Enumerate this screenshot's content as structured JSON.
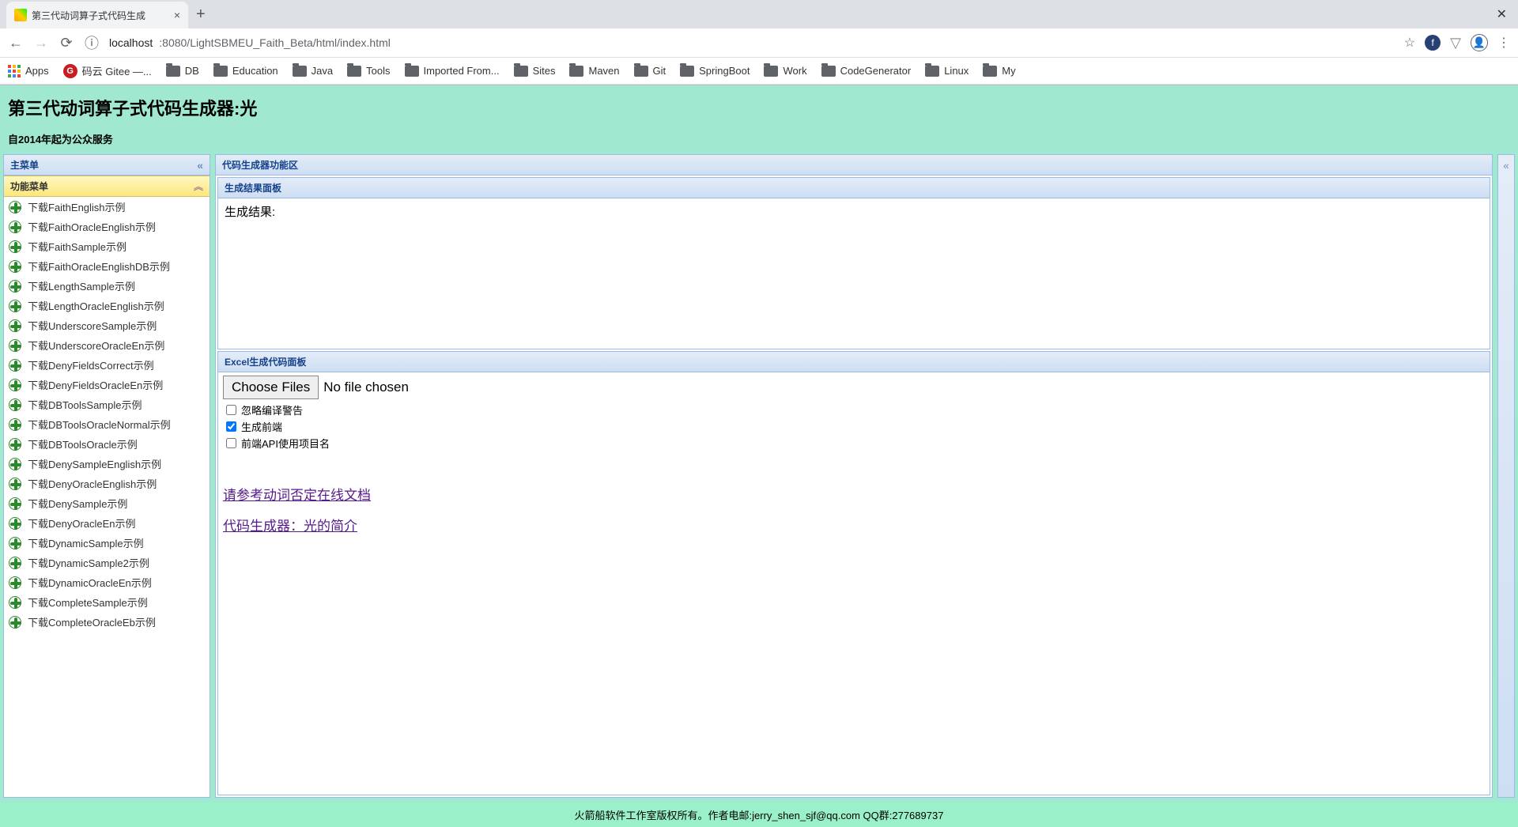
{
  "browser": {
    "tab_title": "第三代动词算子式代码生成",
    "url_prefix": "localhost",
    "url_port_path": ":8080/LightSBMEU_Faith_Beta/html/index.html",
    "bookmarks": {
      "apps": "Apps",
      "gitee": "码云 Gitee —...",
      "items": [
        "DB",
        "Education",
        "Java",
        "Tools",
        "Imported From...",
        "Sites",
        "Maven",
        "Git",
        "SpringBoot",
        "Work",
        "CodeGenerator",
        "Linux",
        "My"
      ]
    }
  },
  "header": {
    "title": "第三代动词算子式代码生成器:光",
    "subtitle": "自2014年起为公众服务"
  },
  "sidebar": {
    "main_menu": "主菜单",
    "func_menu": "功能菜单",
    "items": [
      "下载FaithEnglish示例",
      "下载FaithOracleEnglish示例",
      "下载FaithSample示例",
      "下载FaithOracleEnglishDB示例",
      "下载LengthSample示例",
      "下载LengthOracleEnglish示例",
      "下载UnderscoreSample示例",
      "下载UnderscoreOracleEn示例",
      "下载DenyFieldsCorrect示例",
      "下载DenyFieldsOracleEn示例",
      "下载DBToolsSample示例",
      "下载DBToolsOracleNormal示例",
      "下载DBToolsOracle示例",
      "下载DenySampleEnglish示例",
      "下载DenyOracleEnglish示例",
      "下载DenySample示例",
      "下载DenyOracleEn示例",
      "下载DynamicSample示例",
      "下载DynamicSample2示例",
      "下载DynamicOracleEn示例",
      "下载CompleteSample示例",
      "下载CompleteOracleEb示例"
    ]
  },
  "main": {
    "region_title": "代码生成器功能区",
    "result_panel_title": "生成结果面板",
    "result_label": "生成结果:",
    "excel_panel_title": "Excel生成代码面板",
    "choose_files": "Choose Files",
    "no_file": "No file chosen",
    "chk_ignore": "忽略编译警告",
    "chk_frontend": "生成前端",
    "chk_api": "前端API使用项目名",
    "link1": "请参考动词否定在线文档",
    "link2": "代码生成器：光的简介"
  },
  "footer": "火箭船软件工作室版权所有。作者电邮:jerry_shen_sjf@qq.com QQ群:277689737"
}
